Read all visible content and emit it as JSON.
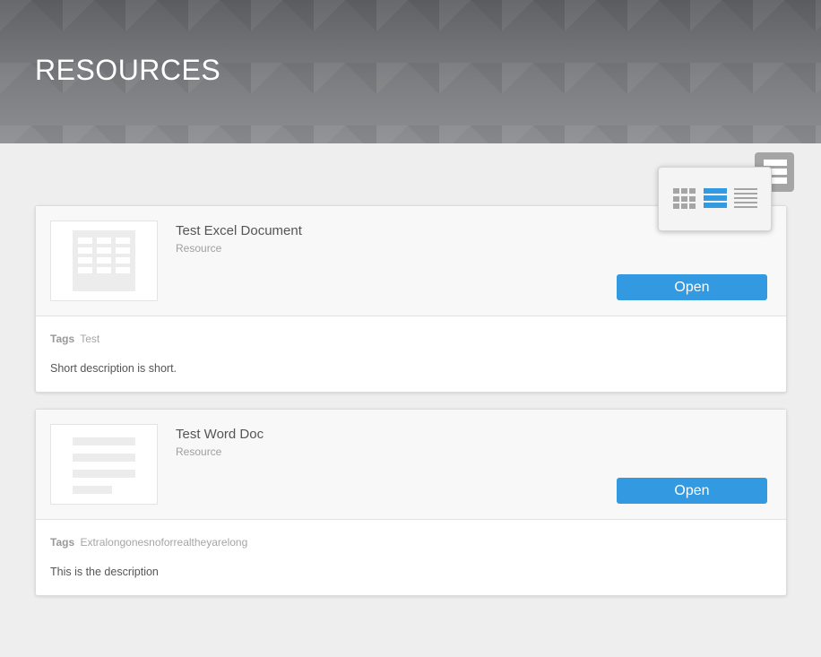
{
  "header": {
    "title": "RESOURCES"
  },
  "view_switcher": {
    "options": [
      "grid-view",
      "list-view",
      "compact-view"
    ],
    "selected": "list-view"
  },
  "resources": [
    {
      "title": "Test Excel Document",
      "type": "Resource",
      "thumbnail": "spreadsheet-icon",
      "open_label": "Open",
      "tags_label": "Tags",
      "tags": "Test",
      "description": "Short description is short."
    },
    {
      "title": "Test Word Doc",
      "type": "Resource",
      "thumbnail": "document-icon",
      "open_label": "Open",
      "tags_label": "Tags",
      "tags": "Extralongonesnoforrealtheyarelong",
      "description": "This is the description"
    }
  ],
  "colors": {
    "accent": "#3399e0",
    "background": "#eeeeee"
  }
}
